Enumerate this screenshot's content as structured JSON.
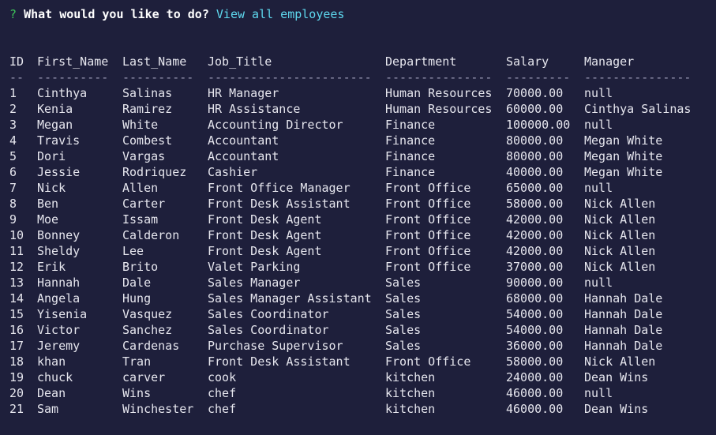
{
  "prompt": {
    "mark": "?",
    "question": "What would you like to do?",
    "answer": "View all employees"
  },
  "table": {
    "headers": [
      "ID",
      "First_Name",
      "Last_Name",
      "Job_Title",
      "Department",
      "Salary",
      "Manager"
    ],
    "separators": [
      "--",
      "----------",
      "----------",
      "-----------------------",
      "---------------",
      "---------",
      "---------------"
    ],
    "rows": [
      [
        "1",
        "Cinthya",
        "Salinas",
        "HR Manager",
        "Human Resources",
        "70000.00",
        "null"
      ],
      [
        "2",
        "Kenia",
        "Ramirez",
        "HR Assistance",
        "Human Resources",
        "60000.00",
        "Cinthya Salinas"
      ],
      [
        "3",
        "Megan",
        "White",
        "Accounting Director",
        "Finance",
        "100000.00",
        "null"
      ],
      [
        "4",
        "Travis",
        "Combest",
        "Accountant",
        "Finance",
        "80000.00",
        "Megan White"
      ],
      [
        "5",
        "Dori",
        "Vargas",
        "Accountant",
        "Finance",
        "80000.00",
        "Megan White"
      ],
      [
        "6",
        "Jessie",
        "Rodriquez",
        "Cashier",
        "Finance",
        "40000.00",
        "Megan White"
      ],
      [
        "7",
        "Nick",
        "Allen",
        "Front Office Manager",
        "Front Office",
        "65000.00",
        "null"
      ],
      [
        "8",
        "Ben",
        "Carter",
        "Front Desk Assistant",
        "Front Office",
        "58000.00",
        "Nick Allen"
      ],
      [
        "9",
        "Moe",
        "Issam",
        "Front Desk Agent",
        "Front Office",
        "42000.00",
        "Nick Allen"
      ],
      [
        "10",
        "Bonney",
        "Calderon",
        "Front Desk Agent",
        "Front Office",
        "42000.00",
        "Nick Allen"
      ],
      [
        "11",
        "Sheldy",
        "Lee",
        "Front Desk Agent",
        "Front Office",
        "42000.00",
        "Nick Allen"
      ],
      [
        "12",
        "Erik",
        "Brito",
        "Valet Parking",
        "Front Office",
        "37000.00",
        "Nick Allen"
      ],
      [
        "13",
        "Hannah",
        "Dale",
        "Sales Manager",
        "Sales",
        "90000.00",
        "null"
      ],
      [
        "14",
        "Angela",
        "Hung",
        "Sales Manager Assistant",
        "Sales",
        "68000.00",
        "Hannah Dale"
      ],
      [
        "15",
        "Yisenia",
        "Vasquez",
        "Sales Coordinator",
        "Sales",
        "54000.00",
        "Hannah Dale"
      ],
      [
        "16",
        "Victor",
        "Sanchez",
        "Sales Coordinator",
        "Sales",
        "54000.00",
        "Hannah Dale"
      ],
      [
        "17",
        "Jeremy",
        "Cardenas",
        "Purchase Supervisor",
        "Sales",
        "36000.00",
        "Hannah Dale"
      ],
      [
        "18",
        "khan",
        "Tran",
        "Front Desk Assistant",
        "Front Office",
        "58000.00",
        "Nick Allen"
      ],
      [
        "19",
        "chuck",
        "carver",
        "cook",
        "kitchen",
        "24000.00",
        "Dean Wins"
      ],
      [
        "20",
        "Dean",
        "Wins",
        "chef",
        "kitchen",
        "46000.00",
        "null"
      ],
      [
        "21",
        "Sam",
        "Winchester",
        "chef",
        "kitchen",
        "46000.00",
        "Dean Wins"
      ]
    ]
  },
  "colors": {
    "background": "#1e1f3b",
    "prompt_mark": "#3ec45a",
    "answer": "#5ed8ee",
    "text": "#e6e6ee"
  }
}
